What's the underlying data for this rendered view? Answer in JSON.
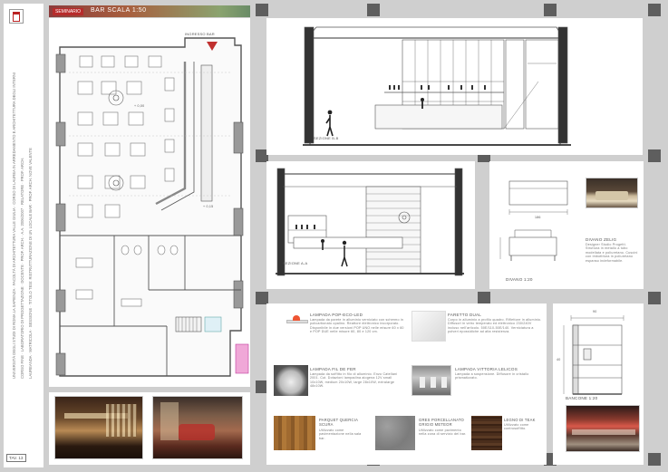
{
  "header": {
    "badge": "SEMINARIO",
    "title": "BAR SCALA 1:50"
  },
  "side_strip": {
    "line1": "UNIVERSITÀ DEGLI STUDI DI ROMA LA SAPIENZA · FACOLTÀ DI ARCHITETTURA VALLE GIULIA · CORSO DI LAUREA IN ARREDAMENTO E ARCHITETTURA DEGLI INTERNI",
    "line2": "CORSO FINE · LABORATORIO DI PROGETTAZIONE · DOCENTE · PROF. ARCH. · A.A. 2006/2007 · RELATORE · PROF. ARCH.",
    "line3": "LAUREANDA · MATRICOLA · SESSIONE · TITOLO TESI: RISTRUTTURAZIONE DI UN LOCALE BAR · PROF. ARCH. NOVE VALENTE",
    "tav": "TAV. 13"
  },
  "plan": {
    "entrance": "INGRESSO BAR",
    "level_1": "+ 0,00",
    "level_2": "+ 0,15"
  },
  "sections": {
    "bb": "SEZIONE B-B",
    "aa": "SEZIONE A-A"
  },
  "sofa": {
    "label": "DIVANO 1:20",
    "dim": "186",
    "title": "DIVANO ZELIG",
    "desc": "Designer Studio Progetti. Struttura in metallo a tubo modellata e poliuretano. Cuscini con imbottitura in poliuretano espanso indeformabile."
  },
  "counter": {
    "label": "BANCONE 1:20",
    "dim1": "90",
    "dim2": "40"
  },
  "lamps": [
    {
      "name": "LAMPADA POP-ECO-LED",
      "desc": "Lampada da parete in alluminio verniciato con schermo in policarbonato opalino. Reattore elettronico incorporato. Disponibile in due versioni POP UNO nelle misure 60 x 60 e POP DUE nelle misure 60, 80 e 120 cm."
    },
    {
      "name": "FARETTO DUAL",
      "desc": "Corpo in alluminio a profilo quadro. Riflettore in alluminio. Diffusori in vetro temperato ed elettronico 230/240V incluso nell'articolo. 50E/110-50E/140. Verniciatura a polveri epossidiche ad alta resistenza."
    },
    {
      "name": "LAMPADA FIL DE FER",
      "desc": "Lampada da soffitto in filo di alluminio. Enzo Catellani 2001. Cut. Dotazioni lampadina alogena 12V small 10x10W, medium 20x10W, large 28x10W, extralarge 48x10W."
    },
    {
      "name": "LAMPADA VITTORIA LELICOS",
      "desc": "Lampada a sospensione. Diffusore in cristallo prismatizzato."
    }
  ],
  "materials": [
    {
      "name": "PARQUET QUERCIA SCURA",
      "desc": "Utilizzato come pavimentazione nella sala bar."
    },
    {
      "name": "GRES PORCELLANATO GRIGIO METEOR",
      "desc": "Utilizzato come pavimento nella zona di servizio del bar."
    },
    {
      "name": "LEGNO DI TEAK",
      "desc": "Utilizzato come controsoffitto."
    }
  ]
}
